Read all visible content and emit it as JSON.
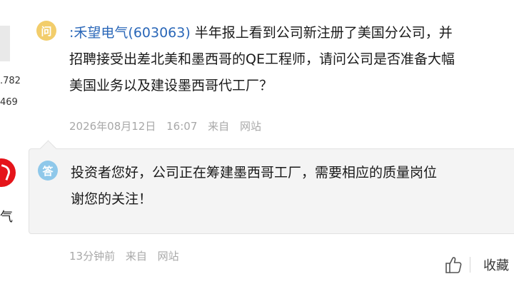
{
  "left": {
    "stat_top": ".782",
    "stat_bottom": "469",
    "company_fragment": "气"
  },
  "question": {
    "badge": "问",
    "stock_link": ":禾望电气(603063)",
    "line1_rest": " 半年报上看到公司新注册了美国分公司，并",
    "line2": "招聘接受出差北美和墨西哥的QE工程师，请问公司是否准备大幅",
    "line3": "美国业务以及建设墨西哥代工厂？",
    "date": "2026年08月12日",
    "time": "16:07",
    "source_prefix": "来自",
    "source": "网站"
  },
  "answer": {
    "badge": "答",
    "line1": "投资者您好，公司正在筹建墨西哥工厂，需要相应的质量岗位",
    "line2": "谢您的关注！",
    "relative_time": "13分钟前",
    "source_prefix": "来自",
    "source": "网站"
  },
  "actions": {
    "like_icon": "thumbs-up-icon",
    "favorite_label": "收藏"
  },
  "colors": {
    "question_badge": "#f2cd6b",
    "answer_badge": "#8fc8ea",
    "link": "#2a67b8",
    "meta": "#a8a8a8"
  }
}
